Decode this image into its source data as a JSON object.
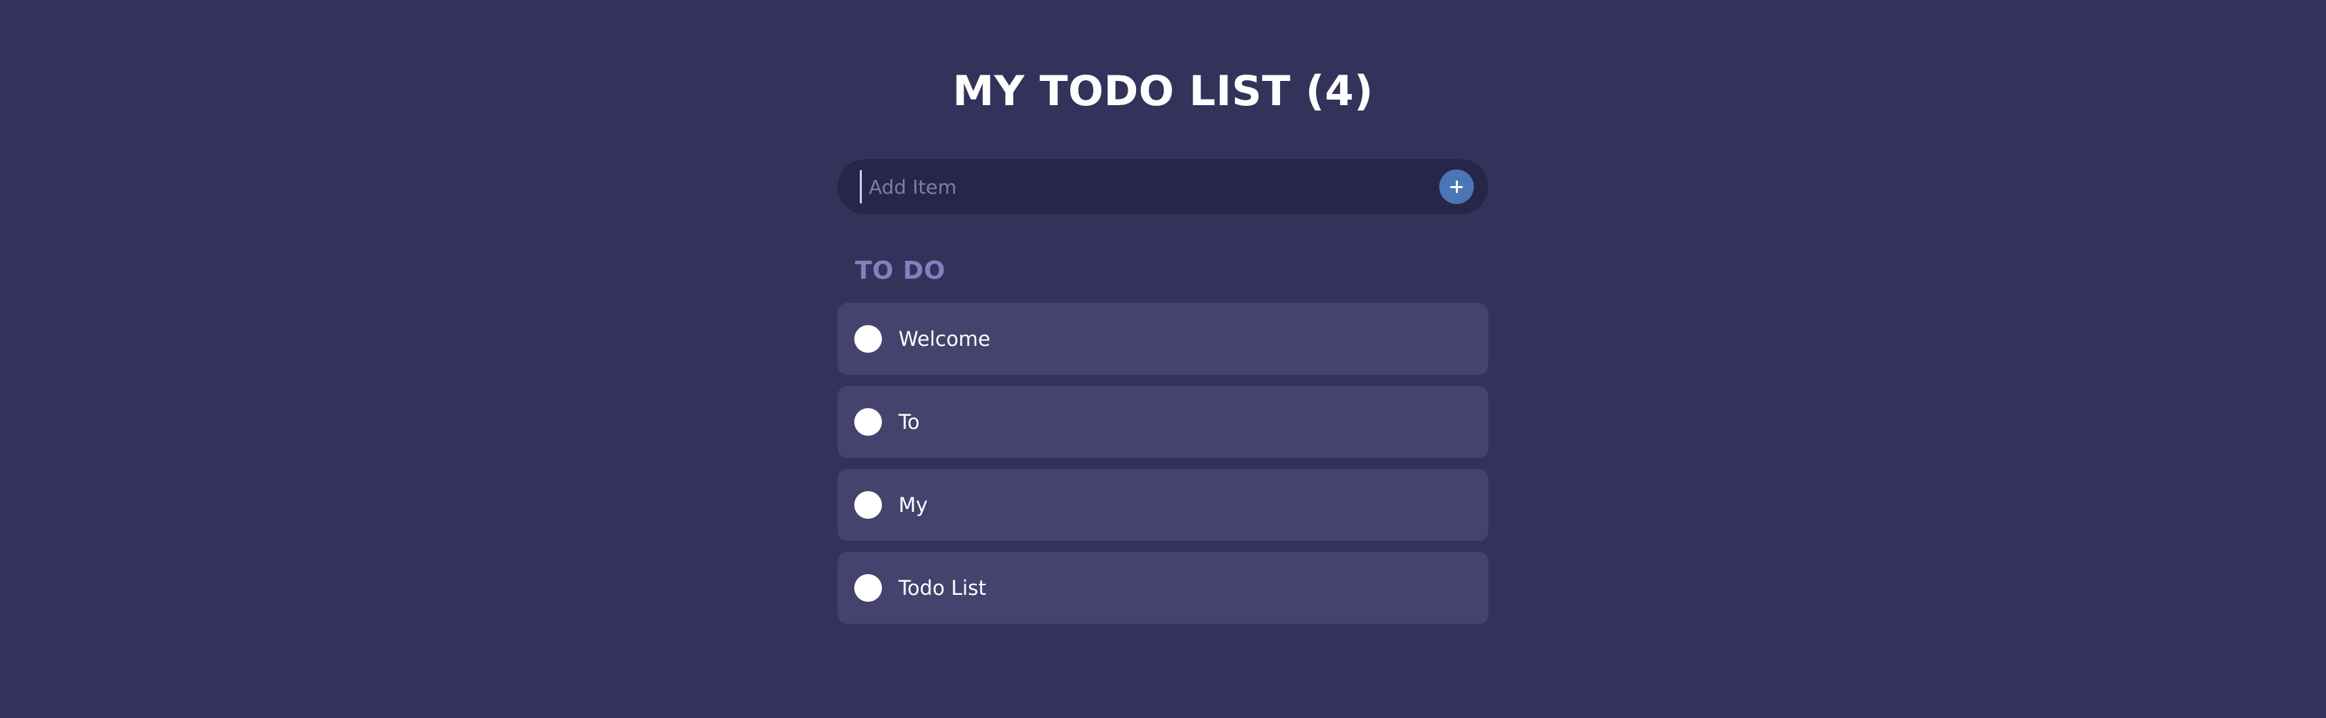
{
  "header": {
    "title": "MY TODO LIST (4)"
  },
  "add_item": {
    "placeholder": "Add Item",
    "value": "",
    "button_icon": "plus-icon"
  },
  "todo_section": {
    "heading": "TO DO",
    "items": [
      {
        "label": "Welcome",
        "completed": false
      },
      {
        "label": "To",
        "completed": false
      },
      {
        "label": "My",
        "completed": false
      },
      {
        "label": "Todo List",
        "completed": false
      }
    ]
  },
  "colors": {
    "background": "#33325a",
    "input_background": "#26254a",
    "item_background": "#45436d",
    "accent": "#4a76b5",
    "section_heading": "#8280bf"
  }
}
